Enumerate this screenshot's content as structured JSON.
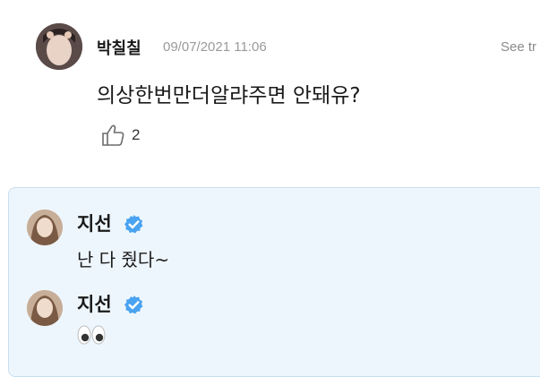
{
  "comment": {
    "author": "박칠칠",
    "timestamp": "09/07/2021 11:06",
    "see_translation": "See tr",
    "text": "의상한번만더알랴주면 안돼유?",
    "like_count": "2"
  },
  "replies": [
    {
      "author": "지선",
      "verified": true,
      "text": "난 다 줬다~"
    },
    {
      "author": "지선",
      "verified": true,
      "text": "",
      "emoji": "eyes-emoji"
    }
  ],
  "colors": {
    "reply_background": "#eef6fd",
    "verified_badge": "#4aa3f0",
    "timestamp": "#9a9a9a"
  }
}
